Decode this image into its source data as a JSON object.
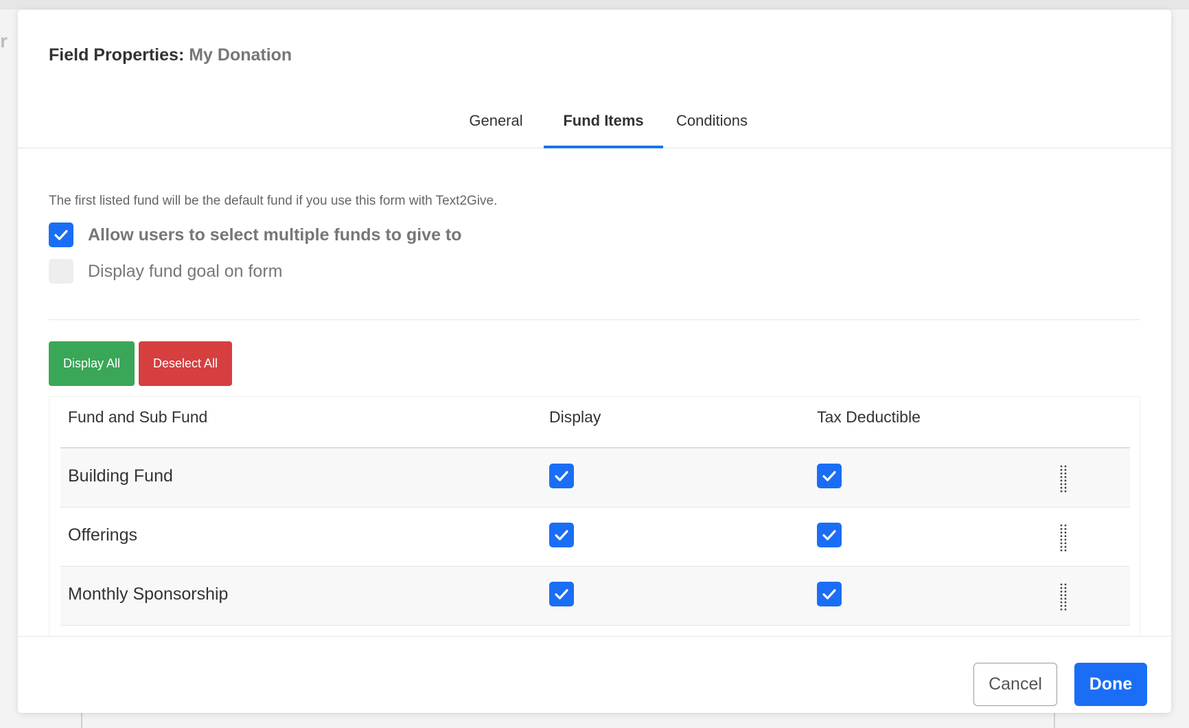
{
  "backdrop": {
    "edge_char": "r"
  },
  "modal": {
    "title_label": "Field Properties:",
    "title_name": "My Donation"
  },
  "tabs": [
    {
      "label": "General",
      "active": false
    },
    {
      "label": "Fund Items",
      "active": true
    },
    {
      "label": "Conditions",
      "active": false
    }
  ],
  "info_text": "The first listed fund will be the default fund if you use this form with Text2Give.",
  "options": [
    {
      "label": "Allow users to select multiple funds to give to",
      "checked": true
    },
    {
      "label": "Display fund goal on form",
      "checked": false
    }
  ],
  "buttons": {
    "display_all": "Display All",
    "deselect_all": "Deselect All",
    "cancel": "Cancel",
    "done": "Done"
  },
  "table": {
    "headers": [
      "Fund and Sub Fund",
      "Display",
      "Tax Deductible"
    ],
    "rows": [
      {
        "name": "Building Fund",
        "display": true,
        "tax_deductible": true
      },
      {
        "name": "Offerings",
        "display": true,
        "tax_deductible": true
      },
      {
        "name": "Monthly Sponsorship",
        "display": true,
        "tax_deductible": true
      },
      {
        "name": "",
        "display": true,
        "tax_deductible": true
      }
    ]
  },
  "colors": {
    "primary": "#1a6ef5",
    "success": "#3aa657",
    "danger": "#d63f3f",
    "tab_underline": "#1a73e8"
  },
  "icons": {
    "checkbox": "check-icon",
    "drag_handle": "drag-handle-icon"
  }
}
